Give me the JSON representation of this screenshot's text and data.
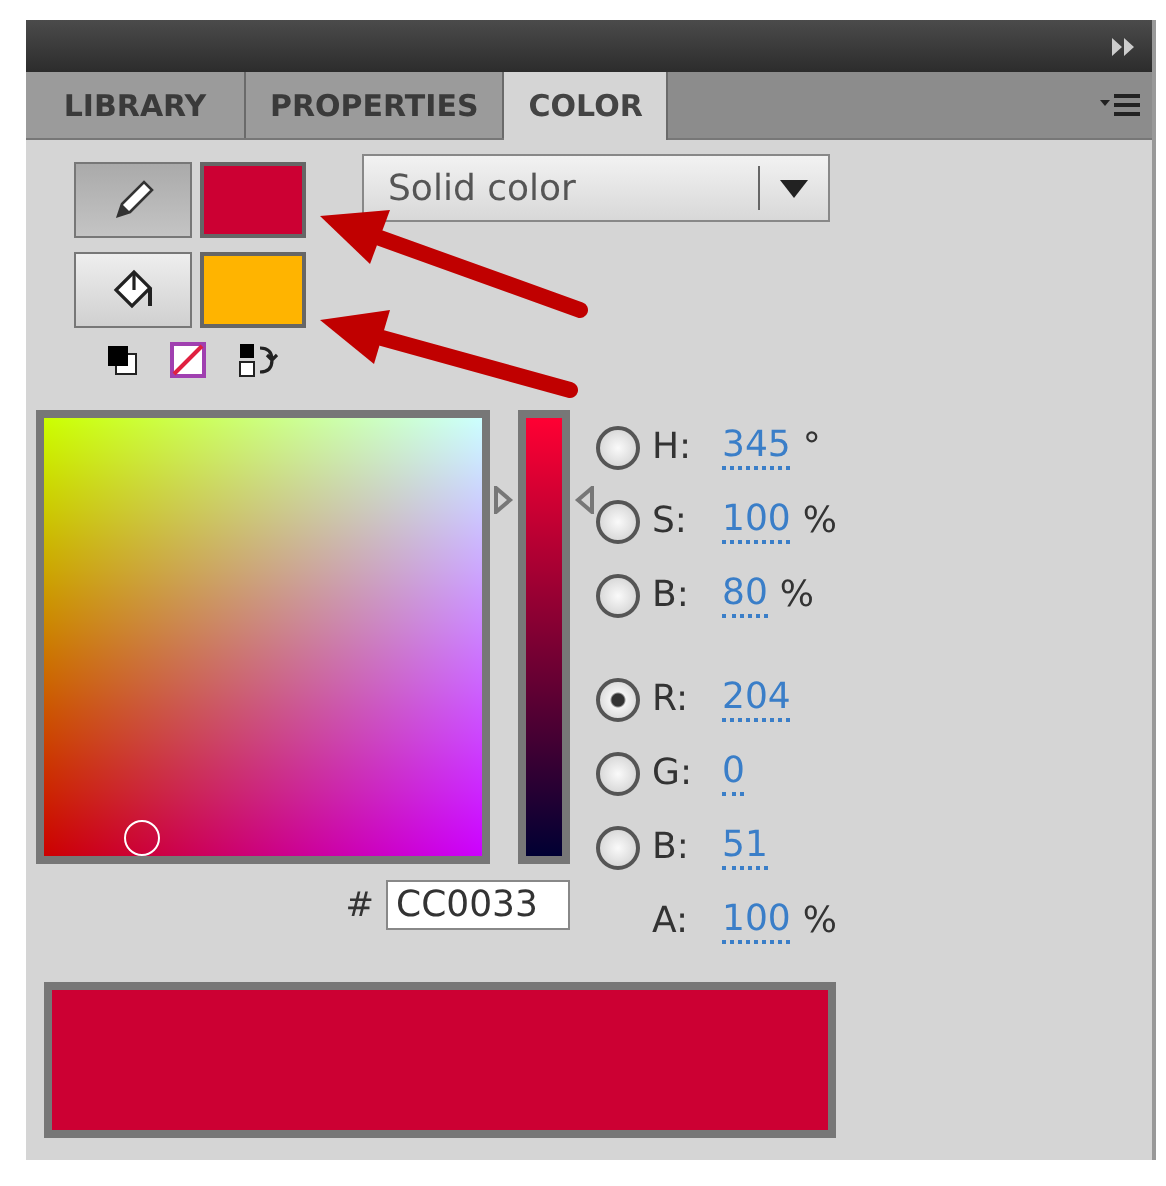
{
  "tabs": [
    {
      "label": "LIBRARY",
      "selected": false
    },
    {
      "label": "PROPERTIES",
      "selected": false
    },
    {
      "label": "COLOR",
      "selected": true
    }
  ],
  "stroke": {
    "color": "#cc0033"
  },
  "fill": {
    "color": "#ffb400"
  },
  "fill_type": {
    "value": "Solid color"
  },
  "channel_slider": {
    "level": 0.8
  },
  "hex": {
    "label": "#",
    "value": "CC0033"
  },
  "fields": [
    {
      "kind": "radio",
      "label": "H:",
      "value": "345",
      "unit": "°",
      "selected": false
    },
    {
      "kind": "radio",
      "label": "S:",
      "value": "100",
      "unit": "%",
      "selected": false
    },
    {
      "kind": "radio",
      "label": "B:",
      "value": "80",
      "unit": "%",
      "selected": false
    },
    {
      "kind": "radio",
      "label": "R:",
      "value": "204",
      "selected": true
    },
    {
      "kind": "radio",
      "label": "G:",
      "value": "0",
      "selected": false
    },
    {
      "kind": "radio",
      "label": "B:",
      "value": "51",
      "selected": false
    },
    {
      "kind": "plain",
      "label": "A:",
      "value": "100",
      "unit": "%"
    }
  ]
}
